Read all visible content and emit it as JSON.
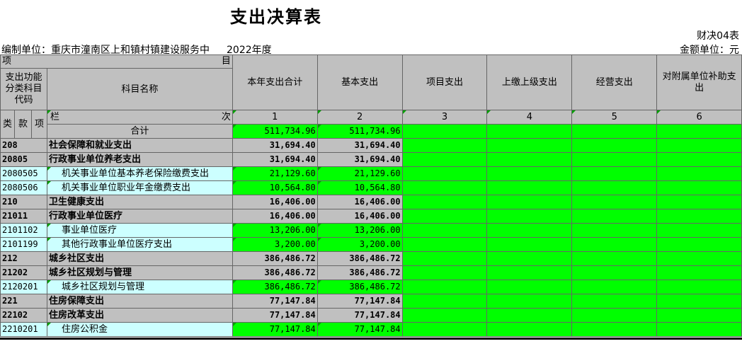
{
  "title": "支出决算表",
  "report_code": "财决04表",
  "unit_label": "编制单位：重庆市潼南区上和镇村镇建设服务中",
  "year": "2022年度",
  "amount_unit": "金额单位：元",
  "headers": {
    "xiang": "项",
    "mu": "目",
    "code_header": "支出功能分类科目代码",
    "subject_name": "科目名称",
    "cols": [
      "本年支出合计",
      "基本支出",
      "项目支出",
      "上缴上级支出",
      "经营支出",
      "对附属单位补助支出"
    ],
    "lei": "类",
    "kuan": "款",
    "xiang2": "项",
    "lan": "栏",
    "ci": "次",
    "col_nums": [
      "1",
      "2",
      "3",
      "4",
      "5",
      "6"
    ]
  },
  "total_row": {
    "label": "合计",
    "values": [
      "511,734.96",
      "511,734.96"
    ]
  },
  "rows": [
    {
      "code": "208",
      "name": "社会保障和就业支出",
      "level": "class",
      "values": [
        "31,694.40",
        "31,694.40"
      ]
    },
    {
      "code": "20805",
      "name": "行政事业单位养老支出",
      "level": "class",
      "values": [
        "31,694.40",
        "31,694.40"
      ]
    },
    {
      "code": "2080505",
      "name": "机关事业单位基本养老保险缴费支出",
      "level": "item",
      "values": [
        "21,129.60",
        "21,129.60"
      ]
    },
    {
      "code": "2080506",
      "name": "机关事业单位职业年金缴费支出",
      "level": "item",
      "values": [
        "10,564.80",
        "10,564.80"
      ]
    },
    {
      "code": "210",
      "name": "卫生健康支出",
      "level": "class",
      "values": [
        "16,406.00",
        "16,406.00"
      ]
    },
    {
      "code": "21011",
      "name": "行政事业单位医疗",
      "level": "class",
      "values": [
        "16,406.00",
        "16,406.00"
      ]
    },
    {
      "code": "2101102",
      "name": "事业单位医疗",
      "level": "item",
      "values": [
        "13,206.00",
        "13,206.00"
      ]
    },
    {
      "code": "2101199",
      "name": "其他行政事业单位医疗支出",
      "level": "item",
      "values": [
        "3,200.00",
        "3,200.00"
      ]
    },
    {
      "code": "212",
      "name": "城乡社区支出",
      "level": "class",
      "values": [
        "386,486.72",
        "386,486.72"
      ]
    },
    {
      "code": "21202",
      "name": "城乡社区规划与管理",
      "level": "class",
      "values": [
        "386,486.72",
        "386,486.72"
      ]
    },
    {
      "code": "2120201",
      "name": "城乡社区规划与管理",
      "level": "item",
      "values": [
        "386,486.72",
        "386,486.72"
      ]
    },
    {
      "code": "221",
      "name": "住房保障支出",
      "level": "class",
      "values": [
        "77,147.84",
        "77,147.84"
      ]
    },
    {
      "code": "22102",
      "name": "住房改革支出",
      "level": "class",
      "values": [
        "77,147.84",
        "77,147.84"
      ]
    },
    {
      "code": "2210201",
      "name": "住房公积金",
      "level": "item",
      "values": [
        "77,147.84",
        "77,147.84"
      ]
    }
  ]
}
